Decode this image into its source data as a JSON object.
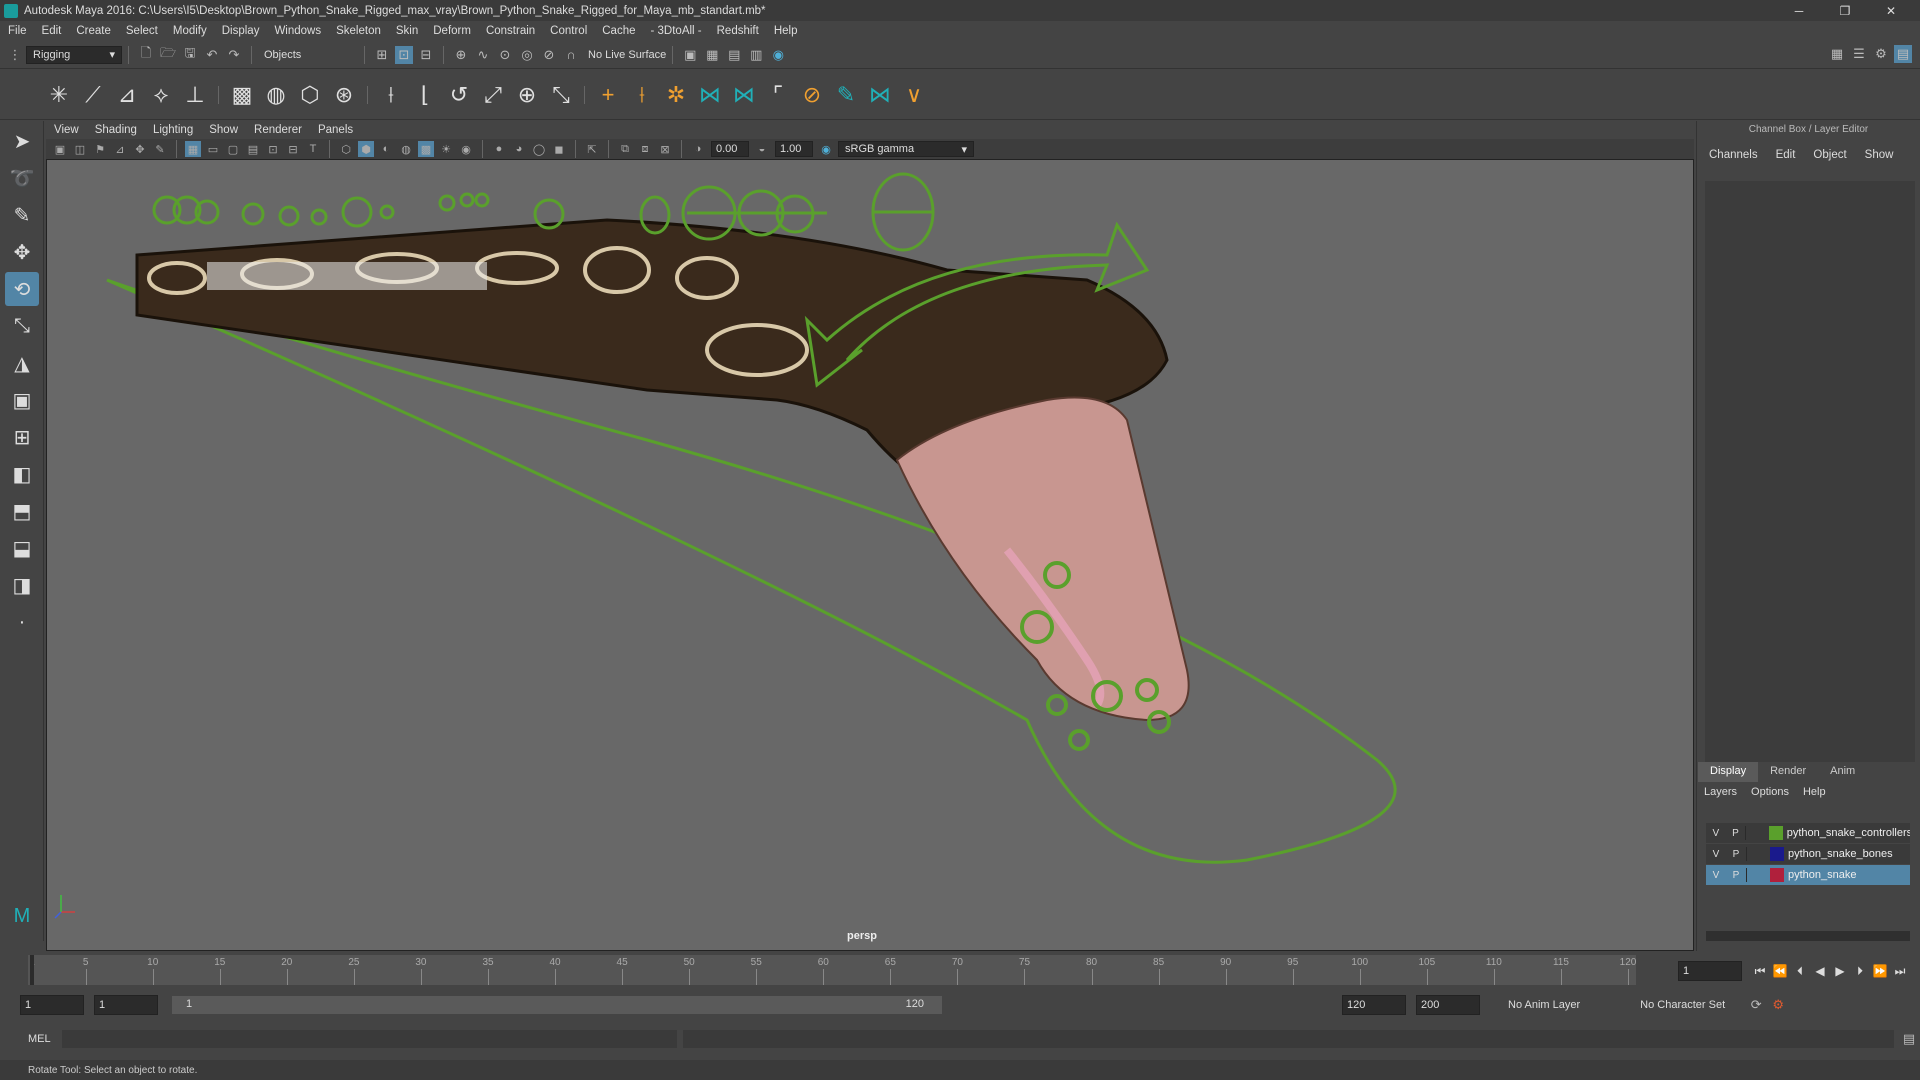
{
  "window": {
    "title": "Autodesk Maya 2016: C:\\Users\\I5\\Desktop\\Brown_Python_Snake_Rigged_max_vray\\Brown_Python_Snake_Rigged_for_Maya_mb_standart.mb*",
    "minimize": "─",
    "maximize": "❐",
    "close": "✕"
  },
  "menu": [
    "File",
    "Edit",
    "Create",
    "Select",
    "Modify",
    "Display",
    "Windows",
    "Skeleton",
    "Skin",
    "Deform",
    "Constrain",
    "Control",
    "Cache",
    "- 3DtoAll -",
    "Redshift",
    "Help"
  ],
  "statusline": {
    "mode": "Rigging",
    "selection_mode": "Objects",
    "live_surface": "No Live Surface"
  },
  "panel": {
    "menu": [
      "View",
      "Shading",
      "Lighting",
      "Show",
      "Renderer",
      "Panels"
    ],
    "exposure": "0.00",
    "gamma": "1.00",
    "color_space": "sRGB gamma",
    "camera": "persp"
  },
  "channelbox": {
    "header": "Channel Box / Layer Editor",
    "menu": [
      "Channels",
      "Edit",
      "Object",
      "Show"
    ]
  },
  "layers": {
    "tabs": [
      "Display",
      "Render",
      "Anim"
    ],
    "active_tab": "Display",
    "menu": [
      "Layers",
      "Options",
      "Help"
    ],
    "rows": [
      {
        "v": "V",
        "p": "P",
        "name": "python_snake_controllers",
        "color": "#5aa02c",
        "selected": false
      },
      {
        "v": "V",
        "p": "P",
        "name": "python_snake_bones",
        "color": "#1a1a8c",
        "selected": false
      },
      {
        "v": "V",
        "p": "P",
        "name": "python_snake",
        "color": "#b0203c",
        "selected": true
      }
    ]
  },
  "timeline": {
    "labels": [
      "1",
      "5",
      "10",
      "15",
      "20",
      "25",
      "30",
      "35",
      "40",
      "45",
      "50",
      "55",
      "60",
      "65",
      "70",
      "75",
      "80",
      "85",
      "90",
      "95",
      "100",
      "105",
      "110",
      "115",
      "120"
    ],
    "current_frame": "1"
  },
  "range": {
    "start": "1",
    "playback_start": "1",
    "slider_start": "1",
    "slider_end": "120",
    "playback_end": "120",
    "end": "200",
    "anim_layer": "No Anim Layer",
    "character_set": "No Character Set"
  },
  "cmdline": {
    "label": "MEL"
  },
  "help": {
    "text": "Rotate Tool: Select an object to rotate."
  }
}
